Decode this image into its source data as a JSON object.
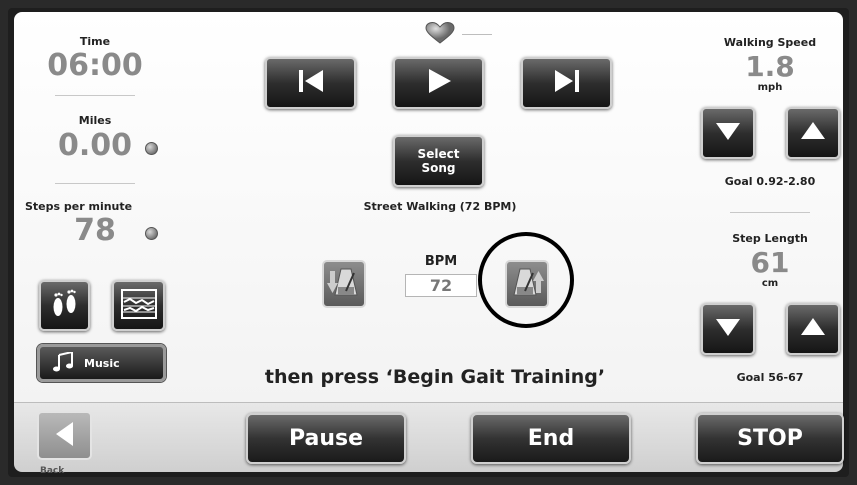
{
  "left": {
    "time_label": "Time",
    "time_value": "06:00",
    "miles_label": "Miles",
    "miles_value": "0.00",
    "spm_label": "Steps per minute",
    "spm_value": "78",
    "music_label": "Music"
  },
  "center": {
    "select_song_line1": "Select",
    "select_song_line2": "Song",
    "song_name": "Street Walking (72 BPM)",
    "bpm_label": "BPM",
    "bpm_value": "72",
    "instruction": "then press ‘Begin Gait Training’"
  },
  "right": {
    "speed_label": "Walking Speed",
    "speed_value": "1.8",
    "speed_unit": "mph",
    "speed_goal": "Goal 0.92-2.80",
    "step_label": "Step Length",
    "step_value": "61",
    "step_unit": "cm",
    "step_goal": "Goal 56-67"
  },
  "bottom": {
    "back_label": "Back",
    "pause_label": "Pause",
    "end_label": "End",
    "stop_label": "STOP"
  }
}
